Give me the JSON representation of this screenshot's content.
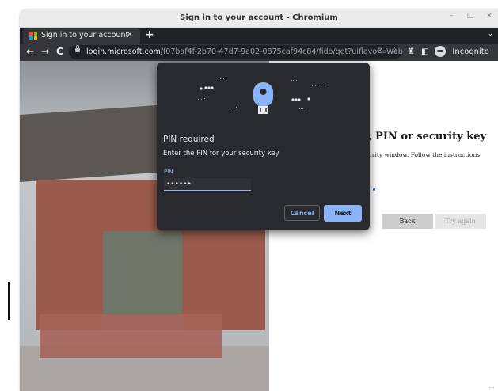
{
  "window": {
    "title": "Sign in to your account - Chromium",
    "controls": [
      "–",
      "□",
      "×"
    ]
  },
  "tab": {
    "title": "Sign in to your account",
    "close": "×",
    "new_tab": "+",
    "favicon_colors": [
      "#f25022",
      "#7fba00",
      "#00a4ef",
      "#ffb900"
    ]
  },
  "toolbar": {
    "back": "←",
    "forward": "→",
    "reload": "C",
    "url_host": "login.microsoft.com",
    "url_path": "/f07baf4f-2b70-47d7-9a02-0875caf94c84/fido/get?uiflavor=Web",
    "incognito_label": "Incognito",
    "icons": [
      "eye-off-icon",
      "star-icon",
      "extensions-icon",
      "side-panel-icon",
      "incognito-icon",
      "menu-icon"
    ]
  },
  "page": {
    "heading": ", PIN or security key",
    "description": "urity window. Follow the instructions",
    "back_label": "Back",
    "try_again_label": "Try again",
    "accent": "#0067b8"
  },
  "dialog": {
    "title": "PIN required",
    "description": "Enter the PIN for your security key",
    "pin_label": "PIN",
    "pin_value": "••••••",
    "cancel_label": "Cancel",
    "next_label": "Next",
    "accent": "#8ab4f8",
    "background": "#292a2d"
  }
}
